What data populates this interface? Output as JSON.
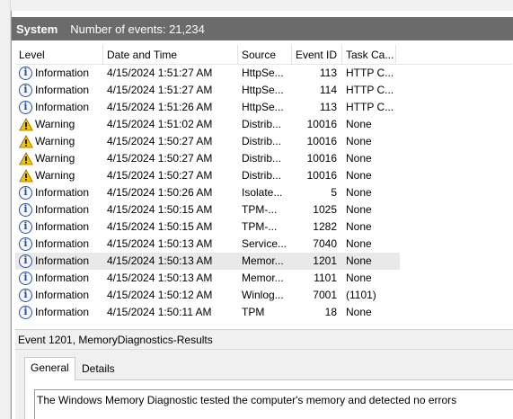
{
  "log": {
    "title": "System",
    "count_text": "Number of events: 21,234"
  },
  "columns": {
    "level": "Level",
    "datetime": "Date and Time",
    "source": "Source",
    "event_id": "Event ID",
    "task": "Task Ca..."
  },
  "events": [
    {
      "level": "Information",
      "datetime": "4/15/2024 1:51:27 AM",
      "source": "HttpSe...",
      "event_id": "113",
      "task": "HTTP C..."
    },
    {
      "level": "Information",
      "datetime": "4/15/2024 1:51:27 AM",
      "source": "HttpSe...",
      "event_id": "114",
      "task": "HTTP C..."
    },
    {
      "level": "Information",
      "datetime": "4/15/2024 1:51:26 AM",
      "source": "HttpSe...",
      "event_id": "113",
      "task": "HTTP C..."
    },
    {
      "level": "Warning",
      "datetime": "4/15/2024 1:51:02 AM",
      "source": "Distrib...",
      "event_id": "10016",
      "task": "None"
    },
    {
      "level": "Warning",
      "datetime": "4/15/2024 1:50:27 AM",
      "source": "Distrib...",
      "event_id": "10016",
      "task": "None"
    },
    {
      "level": "Warning",
      "datetime": "4/15/2024 1:50:27 AM",
      "source": "Distrib...",
      "event_id": "10016",
      "task": "None"
    },
    {
      "level": "Warning",
      "datetime": "4/15/2024 1:50:27 AM",
      "source": "Distrib...",
      "event_id": "10016",
      "task": "None"
    },
    {
      "level": "Information",
      "datetime": "4/15/2024 1:50:26 AM",
      "source": "Isolate...",
      "event_id": "5",
      "task": "None"
    },
    {
      "level": "Information",
      "datetime": "4/15/2024 1:50:15 AM",
      "source": "TPM-...",
      "event_id": "1025",
      "task": "None"
    },
    {
      "level": "Information",
      "datetime": "4/15/2024 1:50:15 AM",
      "source": "TPM-...",
      "event_id": "1282",
      "task": "None"
    },
    {
      "level": "Information",
      "datetime": "4/15/2024 1:50:13 AM",
      "source": "Service...",
      "event_id": "7040",
      "task": "None"
    },
    {
      "level": "Information",
      "datetime": "4/15/2024 1:50:13 AM",
      "source": "Memor...",
      "event_id": "1201",
      "task": "None"
    },
    {
      "level": "Information",
      "datetime": "4/15/2024 1:50:13 AM",
      "source": "Memor...",
      "event_id": "1101",
      "task": "None"
    },
    {
      "level": "Information",
      "datetime": "4/15/2024 1:50:12 AM",
      "source": "Winlog...",
      "event_id": "7001",
      "task": "(1101)"
    },
    {
      "level": "Information",
      "datetime": "4/15/2024 1:50:11 AM",
      "source": "TPM",
      "event_id": "18",
      "task": "None"
    }
  ],
  "selected_index": 11,
  "details": {
    "title": "Event 1201, MemoryDiagnostics-Results",
    "tab_general": "General",
    "tab_details": "Details",
    "message": "The Windows Memory Diagnostic tested the computer's memory and detected no errors"
  },
  "icons": {
    "information": "info-icon",
    "warning": "warning-icon"
  },
  "colors": {
    "header_bg": "#6b6b6b",
    "info_blue": "#2a4f9e",
    "warning_yellow": "#f5c400",
    "selected_row": "#e9e9e9"
  }
}
